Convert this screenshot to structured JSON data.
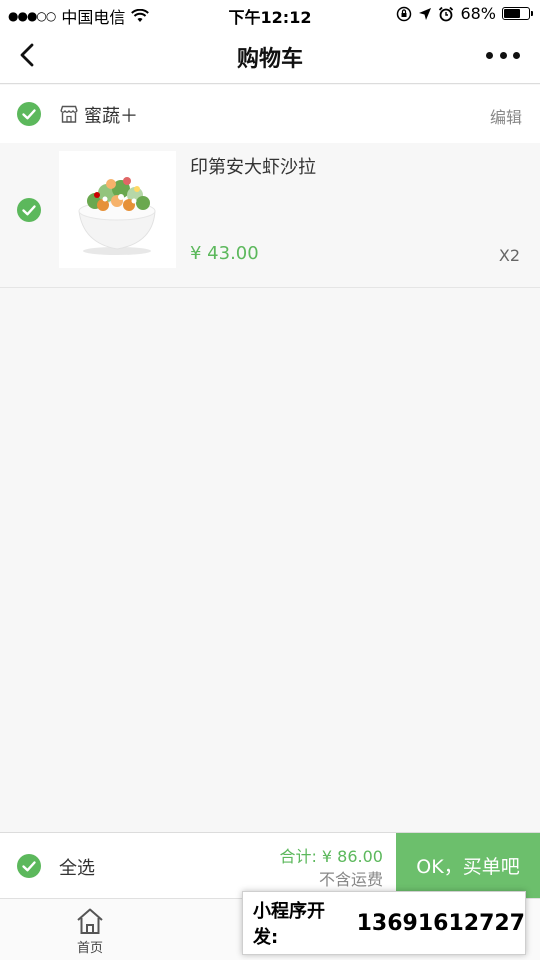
{
  "status_bar": {
    "signal": "●●●○○",
    "carrier": "中国电信",
    "time": "下午12:12",
    "battery": "68%",
    "battery_level": 0.68
  },
  "nav": {
    "title": "购物车"
  },
  "store": {
    "name": "蜜蔬＋",
    "edit_label": "编辑"
  },
  "cart_items": [
    {
      "name": "印第安大虾沙拉",
      "price": "¥ 43.00",
      "quantity": "X2",
      "selected": true
    }
  ],
  "checkout": {
    "select_all_label": "全选",
    "total": "合计: ¥ 86.00",
    "shipping_note": "不含运费",
    "submit_label": "OK，买单吧"
  },
  "tab_bar": {
    "home_label": "首页"
  },
  "promo": {
    "label": "小程序开发:",
    "phone": "13691612727"
  },
  "colors": {
    "accent": "#5cb85c",
    "button": "#6cbf6c",
    "background": "#f7f7f7"
  }
}
